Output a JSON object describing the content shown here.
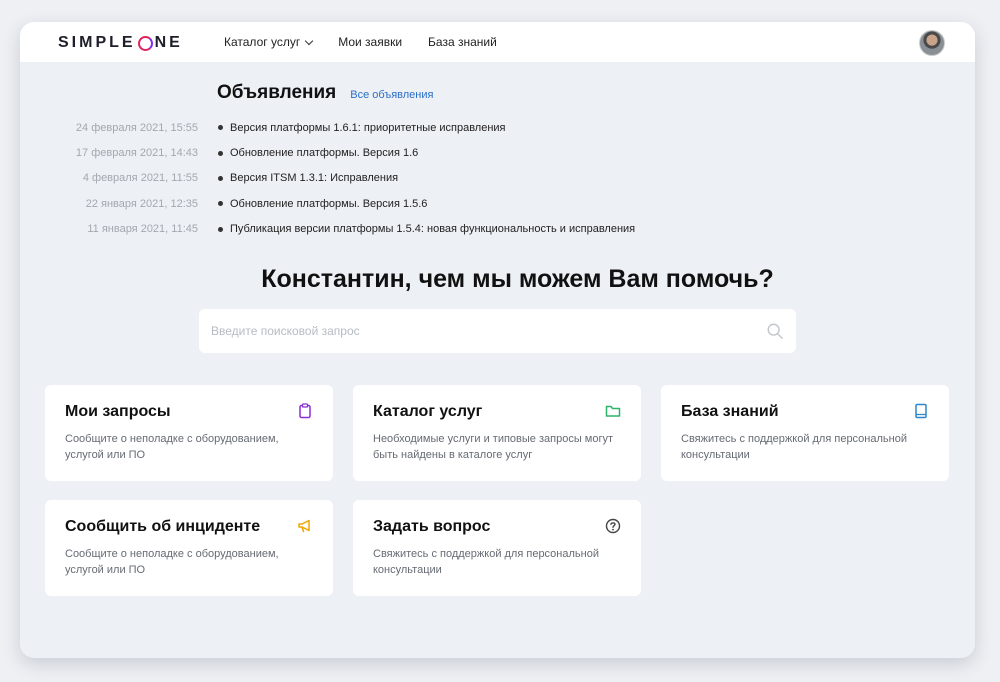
{
  "header": {
    "logo": "SIMPLEONE",
    "logo_parts": [
      "SIMPLE",
      "NE"
    ],
    "nav": [
      {
        "label": "Каталог услуг",
        "has_dropdown": true
      },
      {
        "label": "Мои заявки",
        "has_dropdown": false
      },
      {
        "label": "База знаний",
        "has_dropdown": false
      }
    ]
  },
  "announcements": {
    "title": "Объявления",
    "all_link": "Все объявления",
    "items": [
      {
        "date": "24 февраля 2021, 15:55",
        "text": "Версия платформы 1.6.1: приоритетные исправления"
      },
      {
        "date": "17 февраля 2021, 14:43",
        "text": "Обновление платформы. Версия 1.6"
      },
      {
        "date": "4 февраля 2021, 11:55",
        "text": "Версия ITSM 1.3.1: Исправления"
      },
      {
        "date": "22 января 2021, 12:35",
        "text": "Обновление платформы. Версия 1.5.6"
      },
      {
        "date": "11 января 2021, 11:45",
        "text": "Публикация версии платформы 1.5.4: новая функциональность и исправления"
      }
    ]
  },
  "greeting": "Константин, чем мы можем Вам помочь?",
  "search": {
    "placeholder": "Введите поисковой запрос",
    "value": ""
  },
  "cards": [
    {
      "title": "Мои запросы",
      "desc": "Сообщите о неполадке с оборудованием, услугой или ПО",
      "icon": "clipboard-icon",
      "color": "#8b2fd6"
    },
    {
      "title": "Каталог услуг",
      "desc": "Необходимые услуги и типовые запросы могут быть найдены в каталоге услуг",
      "icon": "folder-icon",
      "color": "#2bb36b"
    },
    {
      "title": "База знаний",
      "desc": "Свяжитесь с поддержкой для персональной консультации",
      "icon": "book-icon",
      "color": "#2f86c9"
    },
    {
      "title": "Сообщить об инциденте",
      "desc": "Сообщите о неполадке с оборудованием, услугой или ПО",
      "icon": "megaphone-icon",
      "color": "#f0a500"
    },
    {
      "title": "Задать вопрос",
      "desc": "Свяжитесь с поддержкой для персональной консультации",
      "icon": "question-circle-icon",
      "color": "#444444"
    }
  ],
  "colors": {
    "accent_link": "#2a6fc9",
    "logo_o": "#e0245e",
    "background": "#edf0f5"
  }
}
